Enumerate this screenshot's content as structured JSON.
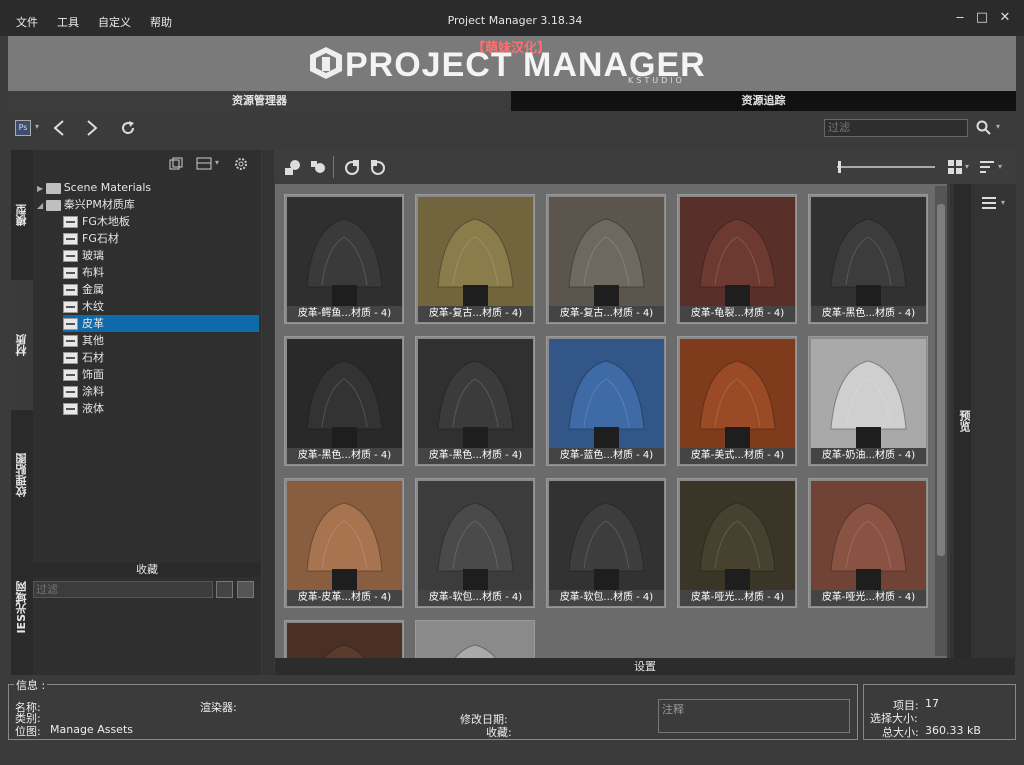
{
  "menu": {
    "items": [
      "文件",
      "工具",
      "自定义",
      "帮助"
    ]
  },
  "window": {
    "title": "Project Manager 3.18.34",
    "min": "‒",
    "max": "□",
    "close": "✕"
  },
  "banner": {
    "tag": "【萌妹汉化】",
    "logo": "PROJECT MANAGER",
    "sub": "KSTUDIO"
  },
  "tabs": [
    "资源管理器",
    "资源追踪"
  ],
  "top_search": {
    "placeholder": "过滤"
  },
  "side_tabs": [
    "模型",
    "材质",
    "纹理贴图",
    "IES光域网"
  ],
  "tree": {
    "roots": [
      "Scene Materials",
      "秦兴PM材质库"
    ],
    "children": [
      "FG木地板",
      "FG石材",
      "玻璃",
      "布料",
      "金属",
      "木纹",
      "皮革",
      "其他",
      "石材",
      "饰面",
      "涂料",
      "液体"
    ],
    "selected": "皮革"
  },
  "favorites": {
    "label": "收藏",
    "filter_placeholder": "过滤"
  },
  "thumbnails": [
    {
      "caption": "皮革-鳄鱼...材质 - 4)",
      "color": "#3a3a3a"
    },
    {
      "caption": "皮革-复古...材质 - 4)",
      "color": "#8b7c4c"
    },
    {
      "caption": "皮革-复古...材质 - 4)",
      "color": "#6f6860"
    },
    {
      "caption": "皮革-龟裂...材质 - 4)",
      "color": "#6d3a32"
    },
    {
      "caption": "皮革-黑色...材质 - 4)",
      "color": "#3c3c3c"
    },
    {
      "caption": "皮革-黑色...材质 - 4)",
      "color": "#333333"
    },
    {
      "caption": "皮革-黑色...材质 - 4)",
      "color": "#3b3b3b"
    },
    {
      "caption": "皮革-蓝色...材质 - 4)",
      "color": "#3e6aa6"
    },
    {
      "caption": "皮革-美式...材质 - 4)",
      "color": "#9a4a24"
    },
    {
      "caption": "皮革-奶油...材质 - 4)",
      "color": "#cfcfcf"
    },
    {
      "caption": "皮革-皮革...材质 - 4)",
      "color": "#a8734f"
    },
    {
      "caption": "皮革-软包...材质 - 4)",
      "color": "#4a4a4a"
    },
    {
      "caption": "皮革-软包...材质 - 4)",
      "color": "#3d3d3d"
    },
    {
      "caption": "皮革-哑光...材质 - 4)",
      "color": "#47412f"
    },
    {
      "caption": "皮革-哑光...材质 - 4)",
      "color": "#8a5242"
    },
    {
      "caption": "",
      "color": "#5a3a2c"
    },
    {
      "caption": "",
      "color": "#a9a9a9"
    }
  ],
  "right_panel": {
    "label": "预览"
  },
  "settings": {
    "label": "设置"
  },
  "info": {
    "title": "信息 :",
    "name_label": "名称:",
    "category_label": "类别:",
    "location_label": "位图:",
    "location_value": "Manage Assets",
    "renderer_label": "渲染器:",
    "modified_label": "修改日期:",
    "favorite_label": "收藏:",
    "note_placeholder": "注释"
  },
  "stats": {
    "items_label": "项目:",
    "items_value": "17",
    "selected_label": "选择大小:",
    "total_label": "总大小:",
    "total_value": "360.33 kB"
  }
}
